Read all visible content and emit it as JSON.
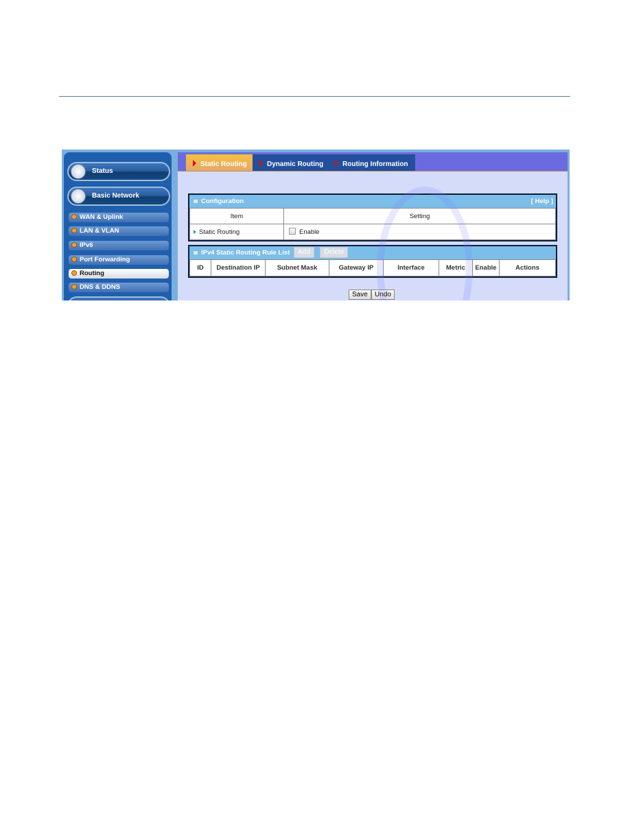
{
  "sidebar": {
    "main_items": [
      {
        "label": "Status",
        "icon": "chart-icon"
      },
      {
        "label": "Basic Network",
        "icon": "globe-icon"
      }
    ],
    "sub_items": [
      {
        "label": "WAN & Uplink",
        "active": false
      },
      {
        "label": "LAN & VLAN",
        "active": false
      },
      {
        "label": "IPv6",
        "active": false
      },
      {
        "label": "Port Forwarding",
        "active": false
      },
      {
        "label": "Routing",
        "active": true
      },
      {
        "label": "DNS & DDNS",
        "active": false
      }
    ]
  },
  "tabs": [
    {
      "label": "Static Routing",
      "active": true
    },
    {
      "label": "Dynamic Routing",
      "active": false
    },
    {
      "label": "Routing Information",
      "active": false
    }
  ],
  "configuration": {
    "title": "Configuration",
    "help": "[ Help ]",
    "columns": [
      "Item",
      "Setting"
    ],
    "rows": [
      {
        "item": "Static Routing",
        "setting_label": "Enable",
        "checked": false
      }
    ]
  },
  "rule_list": {
    "title": "IPv4 Static Routing Rule List",
    "add_label": "Add",
    "delete_label": "Delete",
    "columns": [
      "ID",
      "Destination IP",
      "Subnet Mask",
      "Gateway IP",
      "Interface",
      "Metric",
      "Enable",
      "Actions"
    ]
  },
  "actions": {
    "save_label": "Save",
    "undo_label": "Undo"
  },
  "colors": {
    "tab_active": "#f4c040",
    "tab_inactive": "#234f9d",
    "panel_header": "#7cbde9",
    "content_bg": "#d4dcfa"
  }
}
